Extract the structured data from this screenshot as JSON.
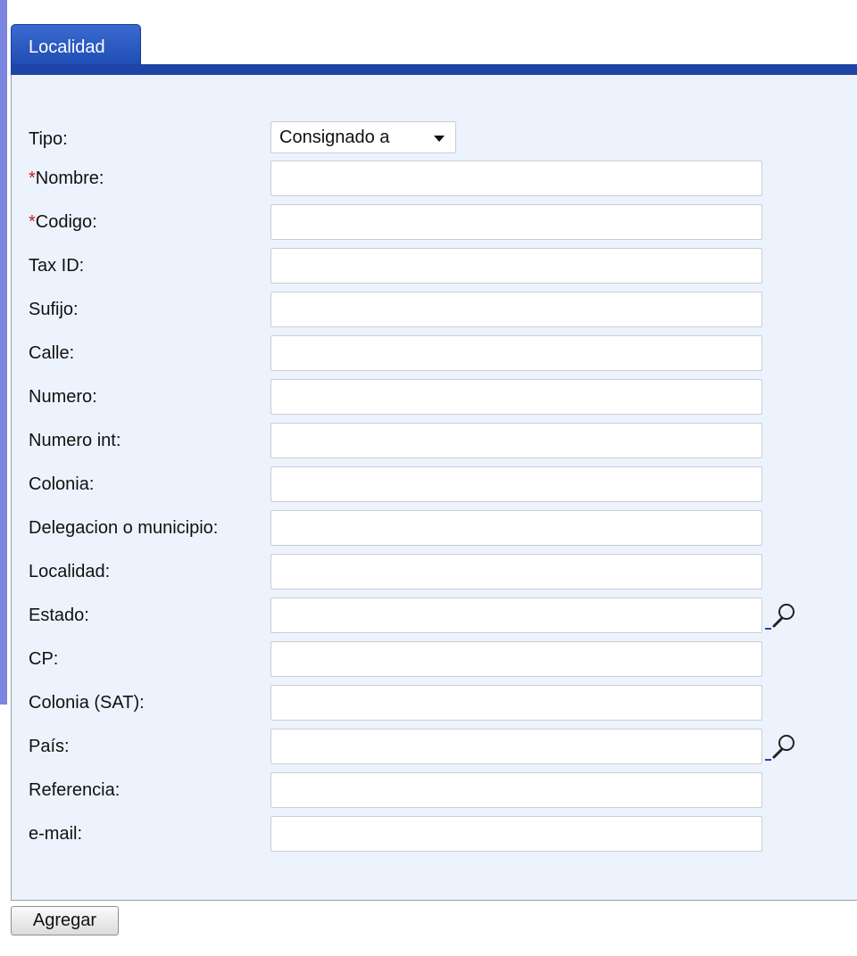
{
  "tab": {
    "label": "Localidad"
  },
  "form": {
    "tipo": {
      "label": "Tipo:",
      "value": "Consignado a"
    },
    "fields": [
      {
        "label": "Nombre:",
        "required": true,
        "value": "",
        "lookup": false
      },
      {
        "label": "Codigo:",
        "required": true,
        "value": "",
        "lookup": false
      },
      {
        "label": "Tax ID:",
        "required": false,
        "value": "",
        "lookup": false
      },
      {
        "label": "Sufijo:",
        "required": false,
        "value": "",
        "lookup": false
      },
      {
        "label": "Calle:",
        "required": false,
        "value": "",
        "lookup": false
      },
      {
        "label": "Numero:",
        "required": false,
        "value": "",
        "lookup": false
      },
      {
        "label": "Numero int:",
        "required": false,
        "value": "",
        "lookup": false
      },
      {
        "label": "Colonia:",
        "required": false,
        "value": "",
        "lookup": false
      },
      {
        "label": "Delegacion o municipio:",
        "required": false,
        "value": "",
        "lookup": false
      },
      {
        "label": "Localidad:",
        "required": false,
        "value": "",
        "lookup": false
      },
      {
        "label": "Estado:",
        "required": false,
        "value": "",
        "lookup": true
      },
      {
        "label": "CP:",
        "required": false,
        "value": "",
        "lookup": false
      },
      {
        "label": "Colonia (SAT):",
        "required": false,
        "value": "",
        "lookup": false
      },
      {
        "label": "País:",
        "required": false,
        "value": "",
        "lookup": true
      },
      {
        "label": "Referencia:",
        "required": false,
        "value": "",
        "lookup": false
      },
      {
        "label": "e-mail:",
        "required": false,
        "value": "",
        "lookup": false
      }
    ],
    "required_marker": "*"
  },
  "actions": {
    "add_label": "Agregar"
  },
  "icons": {
    "lookup": "magnifier-icon"
  },
  "colors": {
    "tab": "#2a5bc6",
    "tab_line": "#1f44a6",
    "panel": "#edf3fd",
    "required": "#cc1f1f"
  }
}
